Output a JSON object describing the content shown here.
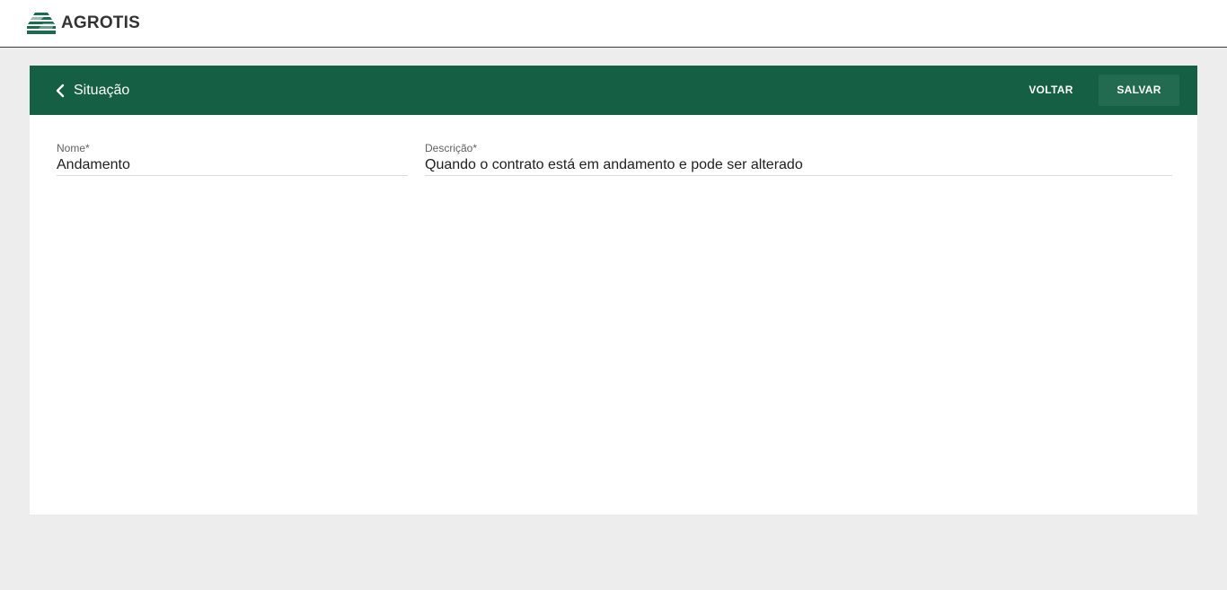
{
  "app": {
    "logo_text": "AGROTIS",
    "logo_icon": "agrotis-logo-icon",
    "brand_color": "#155f45"
  },
  "header": {
    "title": "Situação",
    "back_icon": "chevron-left-icon",
    "voltar_label": "VOLTAR",
    "salvar_label": "SALVAR"
  },
  "form": {
    "nome": {
      "label": "Nome*",
      "value": "Andamento"
    },
    "descricao": {
      "label": "Descrição*",
      "value": "Quando o contrato está em andamento e pode ser alterado"
    }
  }
}
